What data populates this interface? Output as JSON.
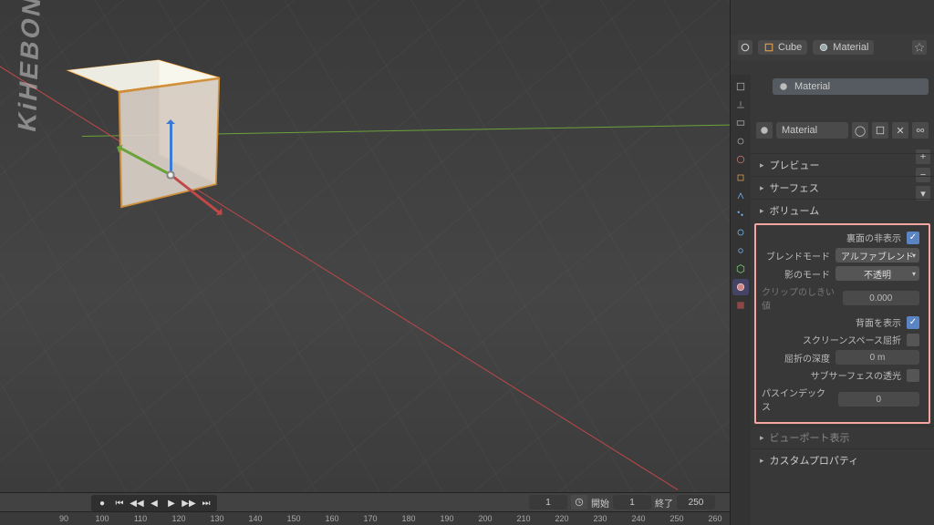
{
  "header": {
    "object_name": "Cube",
    "material_name": "Material"
  },
  "material": {
    "slot_name": "Material",
    "datablock_name": "Material"
  },
  "panels": {
    "preview": "プレビュー",
    "surface": "サーフェス",
    "volume": "ボリューム",
    "viewport": "ビューポート表示",
    "custom_props": "カスタムプロパティ"
  },
  "settings": {
    "backface_culling_label": "裏面の非表示",
    "backface_culling": true,
    "blend_mode_label": "ブレンドモード",
    "blend_mode": "アルファブレンド",
    "shadow_mode_label": "影のモード",
    "shadow_mode": "不透明",
    "clip_threshold_label": "クリップのしきい値",
    "clip_threshold": "0.000",
    "show_backface_label": "背面を表示",
    "show_backface": true,
    "screen_refraction_label": "スクリーンスペース屈折",
    "screen_refraction": false,
    "refraction_depth_label": "屈折の深度",
    "refraction_depth": "0 m",
    "sss_translucency_label": "サブサーフェスの透光",
    "sss_translucency": false,
    "pass_index_label": "パスインデックス",
    "pass_index": "0"
  },
  "timeline": {
    "current": "1",
    "start_label": "開始",
    "start": "1",
    "end_label": "終了",
    "end": "250",
    "ticks": [
      "90",
      "100",
      "110",
      "120",
      "130",
      "140",
      "150",
      "160",
      "170",
      "180",
      "190",
      "200",
      "210",
      "220",
      "230",
      "240",
      "250",
      "260"
    ]
  },
  "watermark": "KiHEBON"
}
